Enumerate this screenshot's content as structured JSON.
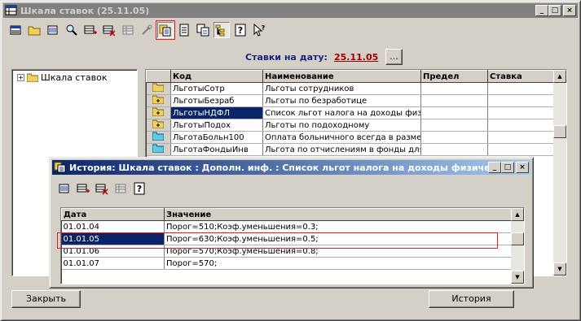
{
  "main_window": {
    "title": "Шкала ставок (25.11.05)",
    "buttons": {
      "minimize": "_",
      "maximize": "□",
      "close": "×"
    }
  },
  "toolbar_icons": [
    "new-item-icon",
    "folder-icon",
    "edit-icon",
    "find-icon",
    "add-row-icon",
    "delete-icon",
    "table-icon",
    "tools-icon",
    "history-icon",
    "document-icon",
    "copy-icon",
    "tree-view-icon",
    "help-icon",
    "context-help-icon"
  ],
  "date_header": {
    "label": "Ставки на дату:",
    "date": "25.11.05",
    "pick_button": "..."
  },
  "tree": {
    "root_label": "Шкала ставок",
    "expand_glyph": "+"
  },
  "grid": {
    "columns": [
      "Код",
      "Наименование",
      "Предел",
      "Ставка"
    ],
    "rows": [
      {
        "code": "ЛьготыСотр",
        "name": "Льготы сотрудников",
        "limit": "",
        "rate": ""
      },
      {
        "code": "ЛьготыБезраб",
        "name": "Льготы по безработице",
        "limit": "",
        "rate": ""
      },
      {
        "code": "ЛьготыНДФЛ",
        "name": "Список льгот налога на доходы физи",
        "limit": "",
        "rate": ""
      },
      {
        "code": "ЛьготыПодох",
        "name": "Льготы по подоходному",
        "limit": "",
        "rate": ""
      },
      {
        "code": "ЛьготаБольн100",
        "name": "Оплата больничного всегда в разме",
        "limit": "",
        "rate": ""
      },
      {
        "code": "ЛьготаФондыИнв",
        "name": "Льгота по отчислениям в фонды для",
        "limit": "",
        "rate": ""
      }
    ]
  },
  "footer": {
    "close_button": "Закрыть",
    "history_button": "История"
  },
  "history_window": {
    "title": "История: Шкала ставок : Дополн. инф. : Список льгот налога на доходы физических л...",
    "columns": [
      "Дата",
      "Значение"
    ],
    "rows": [
      {
        "date": "01.01.04",
        "value": "Порог=510;Коэф.уменьшения=0.3;"
      },
      {
        "date": "01.01.05",
        "value": "Порог=630;Коэф.уменьшения=0.5;"
      },
      {
        "date": "01.01.06",
        "value": "Порог=570;Коэф.уменьшения=0.8;"
      },
      {
        "date": "01.01.07",
        "value": "Порог=570;"
      }
    ]
  }
}
